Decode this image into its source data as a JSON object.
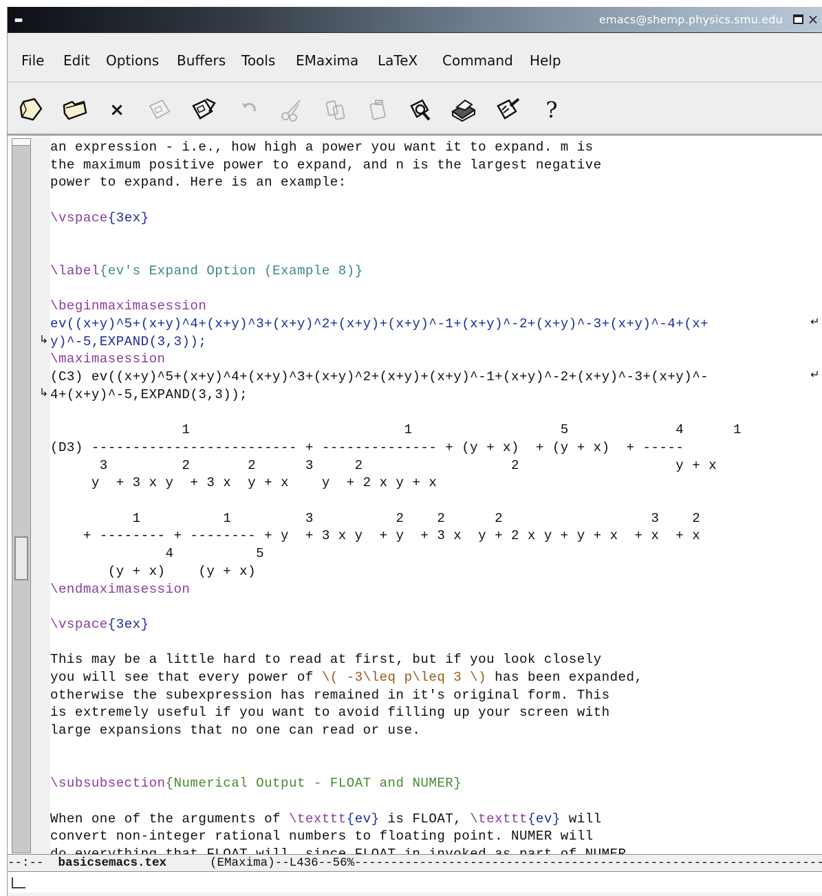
{
  "window": {
    "title": "emacs@shemp.physics.smu.edu",
    "menu_button_glyph": "▬",
    "close_glyph": "×"
  },
  "menubar": {
    "items": [
      "File",
      "Edit",
      "Options",
      "Buffers",
      "Tools",
      "EMaxima",
      "LaTeX",
      "Command",
      "Help"
    ]
  },
  "toolbar": {
    "icons": [
      "open-file-icon",
      "open-folder-icon",
      "close-buffer-icon",
      "save-icon",
      "save-as-icon",
      "undo-icon",
      "cut-icon",
      "copy-icon",
      "paste-icon",
      "search-icon",
      "print-icon",
      "customize-icon",
      "help-icon"
    ],
    "close_glyph": "×",
    "help_glyph": "?"
  },
  "buffer": {
    "lines": [
      {
        "segments": [
          {
            "t": "an expression - i.e., how high a power you want it to expand. m is",
            "c": ""
          }
        ]
      },
      {
        "segments": [
          {
            "t": "the maximum positive power to expand, and n is the largest negative",
            "c": ""
          }
        ]
      },
      {
        "segments": [
          {
            "t": "power to expand. Here is an example:",
            "c": ""
          }
        ]
      },
      {
        "segments": []
      },
      {
        "segments": [
          {
            "t": "\\vspace",
            "c": "latex"
          },
          {
            "t": "{3ex}",
            "c": "blue"
          }
        ]
      },
      {
        "segments": []
      },
      {
        "segments": []
      },
      {
        "segments": [
          {
            "t": "\\label",
            "c": "latex"
          },
          {
            "t": "{ev's Expand Option (Example 8)}",
            "c": "teal"
          }
        ]
      },
      {
        "segments": []
      },
      {
        "segments": [
          {
            "t": "\\beginmaximasession",
            "c": "latex"
          }
        ]
      },
      {
        "segments": [
          {
            "t": "ev((x+y)^5+(x+y)^4+(x+y)^3+(x+y)^2+(x+y)+(x+y)^-1+(x+y)^-2+(x+y)^-3+(x+y)^-4+(x+",
            "c": "blue"
          }
        ],
        "wrap_right": "↵"
      },
      {
        "segments": [
          {
            "t": "y)^-5,EXPAND(3,3));",
            "c": "blue"
          }
        ],
        "wrap_left": "↳"
      },
      {
        "segments": [
          {
            "t": "\\maximasession",
            "c": "latex"
          }
        ]
      },
      {
        "segments": [
          {
            "t": "(C3) ev((x+y)^5+(x+y)^4+(x+y)^3+(x+y)^2+(x+y)+(x+y)^-1+(x+y)^-2+(x+y)^-3+(x+y)^-",
            "c": ""
          }
        ],
        "wrap_right": "↵"
      },
      {
        "segments": [
          {
            "t": "4+(x+y)^-5,EXPAND(3,3));",
            "c": ""
          }
        ],
        "wrap_left": "↳"
      },
      {
        "segments": []
      },
      {
        "segments": [
          {
            "t": "                1                          1                  5             4      1",
            "c": ""
          }
        ]
      },
      {
        "segments": [
          {
            "t": "(D3) ------------------------- + -------------- + (y + x)  + (y + x)  + -----",
            "c": ""
          }
        ]
      },
      {
        "segments": [
          {
            "t": "      3         2       2      3     2                  2                   y + x",
            "c": ""
          }
        ]
      },
      {
        "segments": [
          {
            "t": "     y  + 3 x y  + 3 x  y + x    y  + 2 x y + x",
            "c": ""
          }
        ]
      },
      {
        "segments": []
      },
      {
        "segments": [
          {
            "t": "          1          1         3          2    2      2                  3    2",
            "c": ""
          }
        ]
      },
      {
        "segments": [
          {
            "t": "    + -------- + -------- + y  + 3 x y  + y  + 3 x  y + 2 x y + y + x  + x  + x",
            "c": ""
          }
        ]
      },
      {
        "segments": [
          {
            "t": "              4          5",
            "c": ""
          }
        ]
      },
      {
        "segments": [
          {
            "t": "       (y + x)    (y + x)",
            "c": ""
          }
        ]
      },
      {
        "segments": [
          {
            "t": "\\endmaximasession",
            "c": "latex"
          }
        ]
      },
      {
        "segments": []
      },
      {
        "segments": [
          {
            "t": "\\vspace",
            "c": "latex"
          },
          {
            "t": "{3ex}",
            "c": "blue"
          }
        ]
      },
      {
        "segments": []
      },
      {
        "segments": [
          {
            "t": "This may be a little hard to read at first, but if you look closely",
            "c": ""
          }
        ]
      },
      {
        "segments": [
          {
            "t": "you will see that every power of ",
            "c": ""
          },
          {
            "t": "\\( -3\\leq p\\leq 3 \\)",
            "c": "math"
          },
          {
            "t": " has been expanded,",
            "c": ""
          }
        ]
      },
      {
        "segments": [
          {
            "t": "otherwise the subexpression has remained in it's original form. This",
            "c": ""
          }
        ]
      },
      {
        "segments": [
          {
            "t": "is extremely useful if you want to avoid filling up your screen with",
            "c": ""
          }
        ]
      },
      {
        "segments": [
          {
            "t": "large expansions that no one can read or use.",
            "c": ""
          }
        ]
      },
      {
        "segments": []
      },
      {
        "segments": []
      },
      {
        "segments": [
          {
            "t": "\\subsubsection",
            "c": "latex"
          },
          {
            "t": "{Numerical Output - FLOAT and NUMER}",
            "c": "green"
          }
        ]
      },
      {
        "segments": []
      },
      {
        "segments": [
          {
            "t": "When one of the arguments of ",
            "c": ""
          },
          {
            "t": "\\texttt",
            "c": "latex"
          },
          {
            "t": "{ev}",
            "c": "blue"
          },
          {
            "t": " is FLOAT, ",
            "c": ""
          },
          {
            "t": "\\texttt",
            "c": "latex"
          },
          {
            "t": "{ev}",
            "c": "blue"
          },
          {
            "t": " will",
            "c": ""
          }
        ]
      },
      {
        "segments": [
          {
            "t": "convert non-integer rational numbers to floating point. NUMER will",
            "c": ""
          }
        ]
      },
      {
        "segments": [
          {
            "t": "do everything that FLOAT will, since FLOAT in invoked as part of NUMER,",
            "c": ""
          }
        ]
      }
    ]
  },
  "modeline": {
    "prefix": "--:--  ",
    "buffer_name": "basicsemacs.tex",
    "mode_info": "      (EMaxima)--L436--56%",
    "fill": "--------------------------------------------------------------------"
  },
  "colors": {
    "latex_command": "#8a3d9e",
    "brace_argument": "#1f2a9c",
    "label_argument": "#3a8a86",
    "section_argument": "#4a8a34",
    "math_inline": "#9a5a18"
  }
}
